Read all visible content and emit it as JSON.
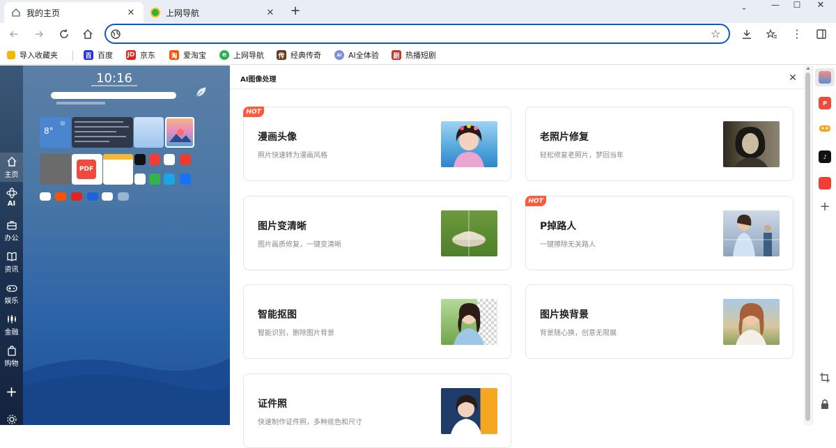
{
  "tabs": [
    {
      "title": "我的主页",
      "active": true
    },
    {
      "title": "上网导航",
      "active": false
    }
  ],
  "bookmarks": [
    {
      "label": "导入收藏夹",
      "color": "#f2b705",
      "glyph": ""
    },
    {
      "label": "百度",
      "color": "#2932e1",
      "glyph": "百"
    },
    {
      "label": "京东",
      "color": "#e1251b",
      "glyph": "JD"
    },
    {
      "label": "爱淘宝",
      "color": "#ff5000",
      "glyph": "淘"
    },
    {
      "label": "上网导航",
      "color": "#2bb24c",
      "glyph": "e"
    },
    {
      "label": "经典传奇",
      "color": "#6b3a1e",
      "glyph": "传"
    },
    {
      "label": "AI全体验",
      "color": "#7b8fd6",
      "glyph": "AI"
    },
    {
      "label": "热播短剧",
      "color": "#c0392b",
      "glyph": "剧"
    }
  ],
  "leftnav": [
    {
      "label": "主页"
    },
    {
      "label": "AI"
    },
    {
      "label": "办公"
    },
    {
      "label": "资讯"
    },
    {
      "label": "娱乐"
    },
    {
      "label": "金融"
    },
    {
      "label": "购物"
    }
  ],
  "preview": {
    "time": "10:16",
    "temp": "8°"
  },
  "ai_panel": {
    "title": "AI图像处理",
    "hot_label": "HOT",
    "cards": [
      {
        "title": "漫画头像",
        "subtitle": "照片快速转为漫画风格",
        "hot": true
      },
      {
        "title": "老照片修复",
        "subtitle": "轻松修复老照片，梦回当年",
        "hot": false
      },
      {
        "title": "图片变清晰",
        "subtitle": "图片画质修复，一键变清晰",
        "hot": false
      },
      {
        "title": "P掉路人",
        "subtitle": "一键擦除无关路人",
        "hot": true
      },
      {
        "title": "智能抠图",
        "subtitle": "智能识别，删除图片背景",
        "hot": false
      },
      {
        "title": "图片换背景",
        "subtitle": "背景随心换，创意无限展",
        "hot": false
      },
      {
        "title": "证件照",
        "subtitle": "快速制作证件照，多种底色和尺寸",
        "hot": false
      }
    ]
  },
  "colors": {
    "accent": "#0b57d0",
    "hot": "#ff5a3c"
  }
}
